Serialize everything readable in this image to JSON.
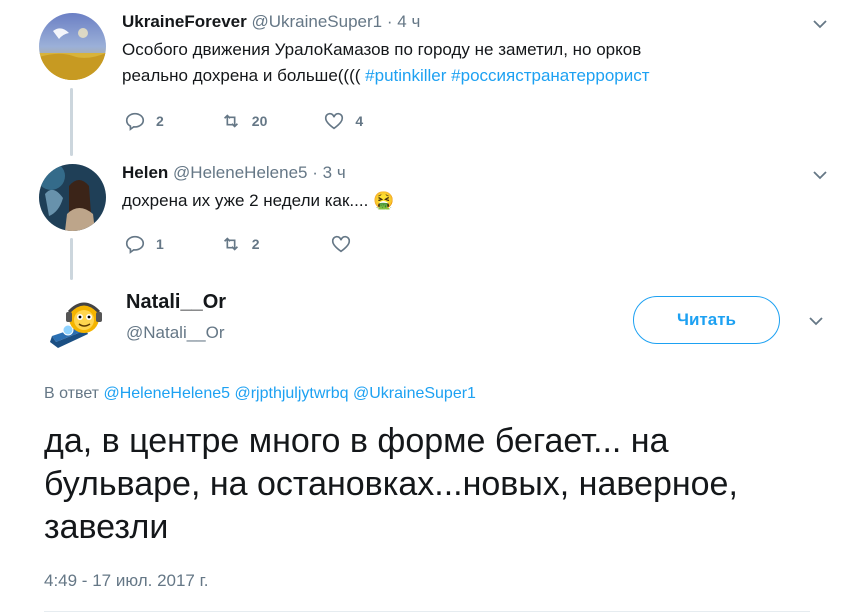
{
  "reply1": {
    "name": "UkraineForever",
    "handle": "@UkraineSuper1",
    "dot": "·",
    "time": "4 ч",
    "line1": "Особого движения УралоКамазов по городу не заметил, но орков",
    "line2_text": "реально дохрена и больше((((",
    "hashtag1": "#putinkiller",
    "hashtag2": "#россиястранатеррорист",
    "replies": "2",
    "retweets": "20",
    "likes": "4"
  },
  "reply2": {
    "name": "Helen",
    "handle": "@HeleneHelene5",
    "dot": "·",
    "time": "3 ч",
    "text": "дохрена их уже 2 недели как....",
    "emoji": "🤮",
    "replies": "1",
    "retweets": "2",
    "likes": ""
  },
  "main": {
    "name": "Natali__Or",
    "handle": "@Natali__Or",
    "follow_label": "Читать",
    "reply_prefix": "В ответ",
    "mentions": [
      "@HeleneHelene5",
      "@rjpthjuljytwrbq",
      "@UkraineSuper1"
    ],
    "text": "да, в центре много в форме бегает... на бульваре, на остановках...новых, наверное, завезли",
    "timestamp": "4:49 - 17 июл. 2017 г."
  },
  "colors": {
    "accent": "#1da1f2",
    "muted": "#657786",
    "text": "#14171a",
    "thread_line": "#ccd6dd"
  },
  "icons": [
    "reply-icon",
    "retweet-icon",
    "like-icon",
    "chevron-down-icon"
  ]
}
